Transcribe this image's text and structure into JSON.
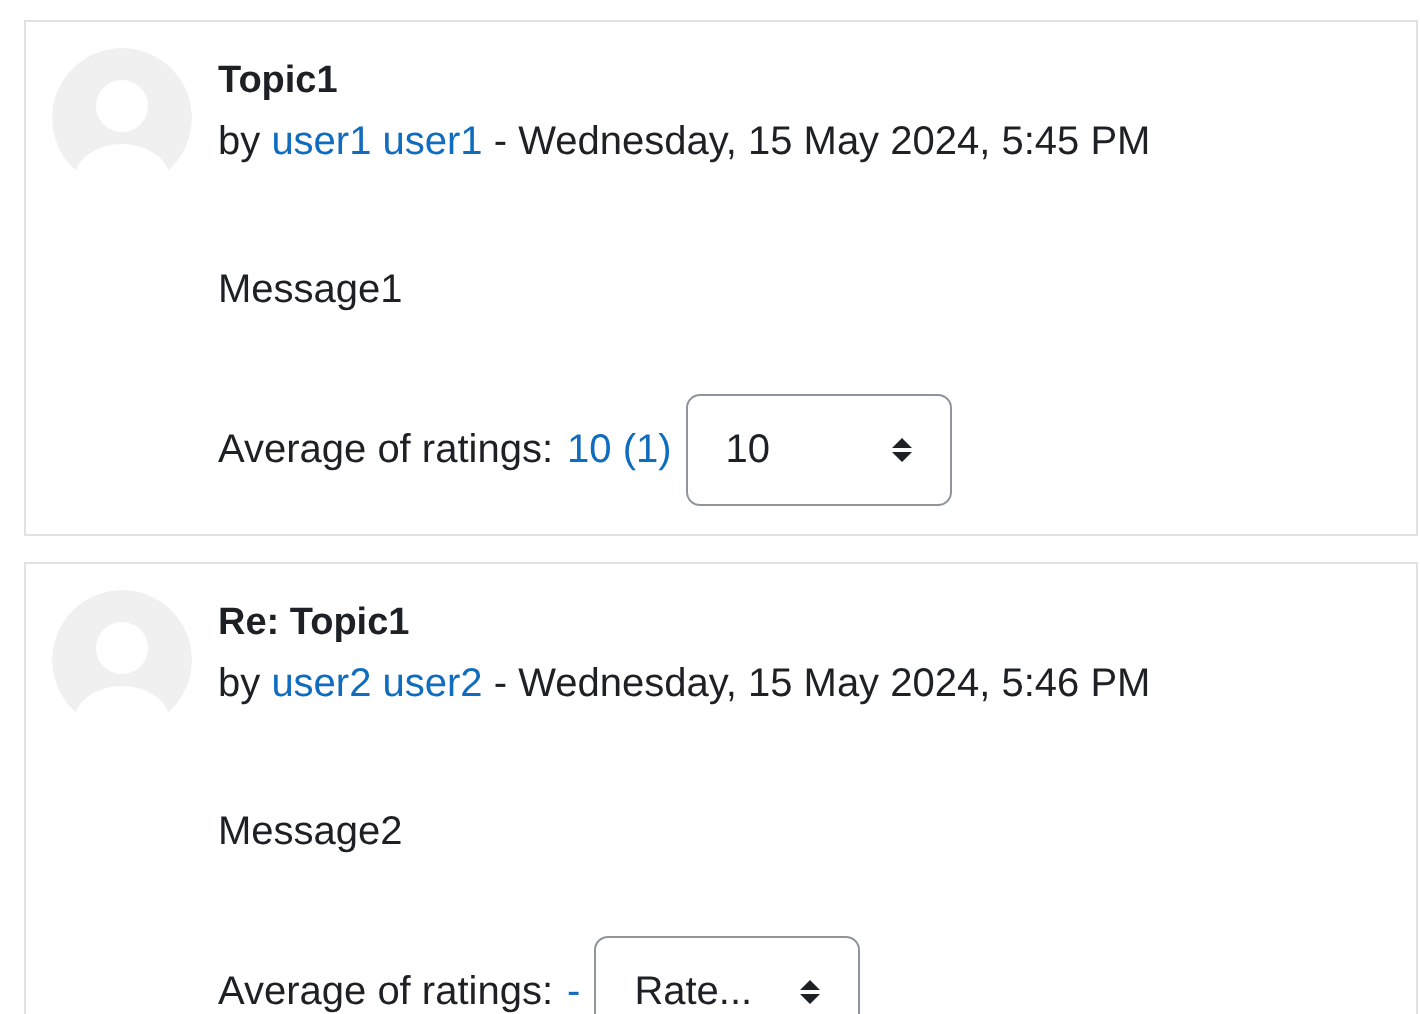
{
  "posts": [
    {
      "title": "Topic1",
      "by": "by",
      "author": "user1 user1",
      "date": "- Wednesday, 15 May 2024, 5:45 PM",
      "message": "Message1",
      "ratings_label": "Average of ratings:",
      "average": "10 (1)",
      "rating_select": "10"
    },
    {
      "title": "Re: Topic1",
      "by": "by",
      "author": "user2 user2",
      "date": "- Wednesday, 15 May 2024, 5:46 PM",
      "message": "Message2",
      "ratings_label": "Average of ratings:",
      "average": "-",
      "rating_select": "Rate..."
    }
  ]
}
